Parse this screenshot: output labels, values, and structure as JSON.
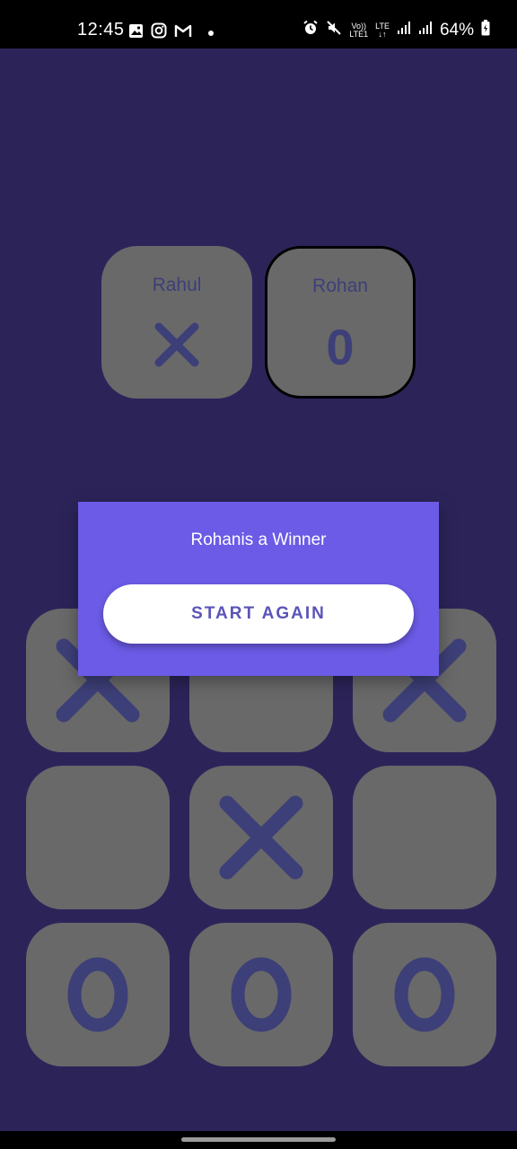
{
  "status_bar": {
    "time": "12:45",
    "battery": "64%",
    "lte_top": "LTE",
    "lte_bottom": "LTE1",
    "volte": "Vo))"
  },
  "players": [
    {
      "name": "Rahul",
      "mark": "X",
      "active": false
    },
    {
      "name": "Rohan",
      "mark": "0",
      "active": true
    }
  ],
  "board": {
    "cells": [
      "X",
      "",
      "X",
      "",
      "X",
      "",
      "0",
      "0",
      "0"
    ]
  },
  "dialog": {
    "message": "Rohanis a Winner",
    "button_label": "START AGAIN"
  },
  "colors": {
    "background": "#2c2459",
    "tile": "#696969",
    "mark": "#3d3f78",
    "dialog": "#6b5be6",
    "button_text": "#5a54b8"
  },
  "icons": {
    "status_left": [
      "gallery-icon",
      "instagram-icon",
      "gmail-icon",
      "notification-dot-icon"
    ],
    "status_right": [
      "alarm-icon",
      "mute-icon",
      "volte-icon",
      "lte-icon",
      "signal-icon",
      "signal-icon",
      "battery-icon"
    ]
  }
}
